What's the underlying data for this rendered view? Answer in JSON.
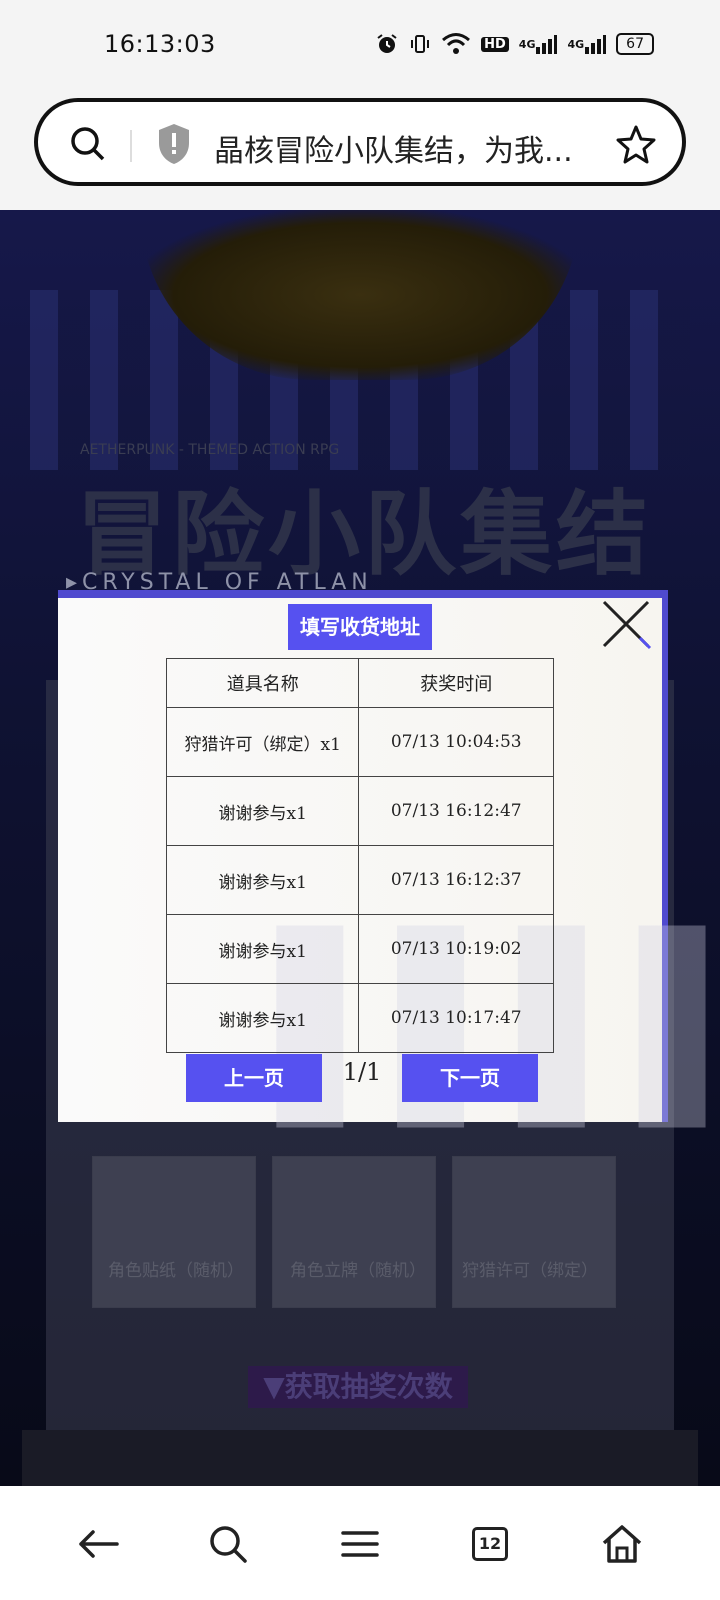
{
  "status_bar": {
    "time": "16:13:03",
    "network_1": "4G",
    "network_2": "4G",
    "hd_label": "HD",
    "battery": "67"
  },
  "address_bar": {
    "page_title": "晶核冒险小队集结，为我..."
  },
  "background": {
    "tag": "AETHERPUNK - THEMED ACTION RPG",
    "title_cn": "冒险小队集结",
    "title_en": "CRYSTAL OF ATLAN",
    "prizes": [
      {
        "label": "角色贴纸（随机）"
      },
      {
        "label": "角色立牌（随机）"
      },
      {
        "label": "狩猎许可（绑定）"
      }
    ],
    "section_heading": "▼获取抽奖次数"
  },
  "modal": {
    "title": "填写收货地址",
    "columns": [
      "道具名称",
      "获奖时间"
    ],
    "rows": [
      {
        "item": "狩猎许可（绑定）x1",
        "time": "07/13 10:04:53"
      },
      {
        "item": "谢谢参与x1",
        "time": "07/13 16:12:47"
      },
      {
        "item": "谢谢参与x1",
        "time": "07/13 16:12:37"
      },
      {
        "item": "谢谢参与x1",
        "time": "07/13 10:19:02"
      },
      {
        "item": "谢谢参与x1",
        "time": "07/13 10:17:47"
      }
    ],
    "prev_label": "上一页",
    "page_indicator": "1/1",
    "next_label": "下一页"
  },
  "navbar": {
    "tabs_count": "12"
  },
  "colors": {
    "accent": "#5651f0",
    "modal_border": "#4f4acf"
  }
}
